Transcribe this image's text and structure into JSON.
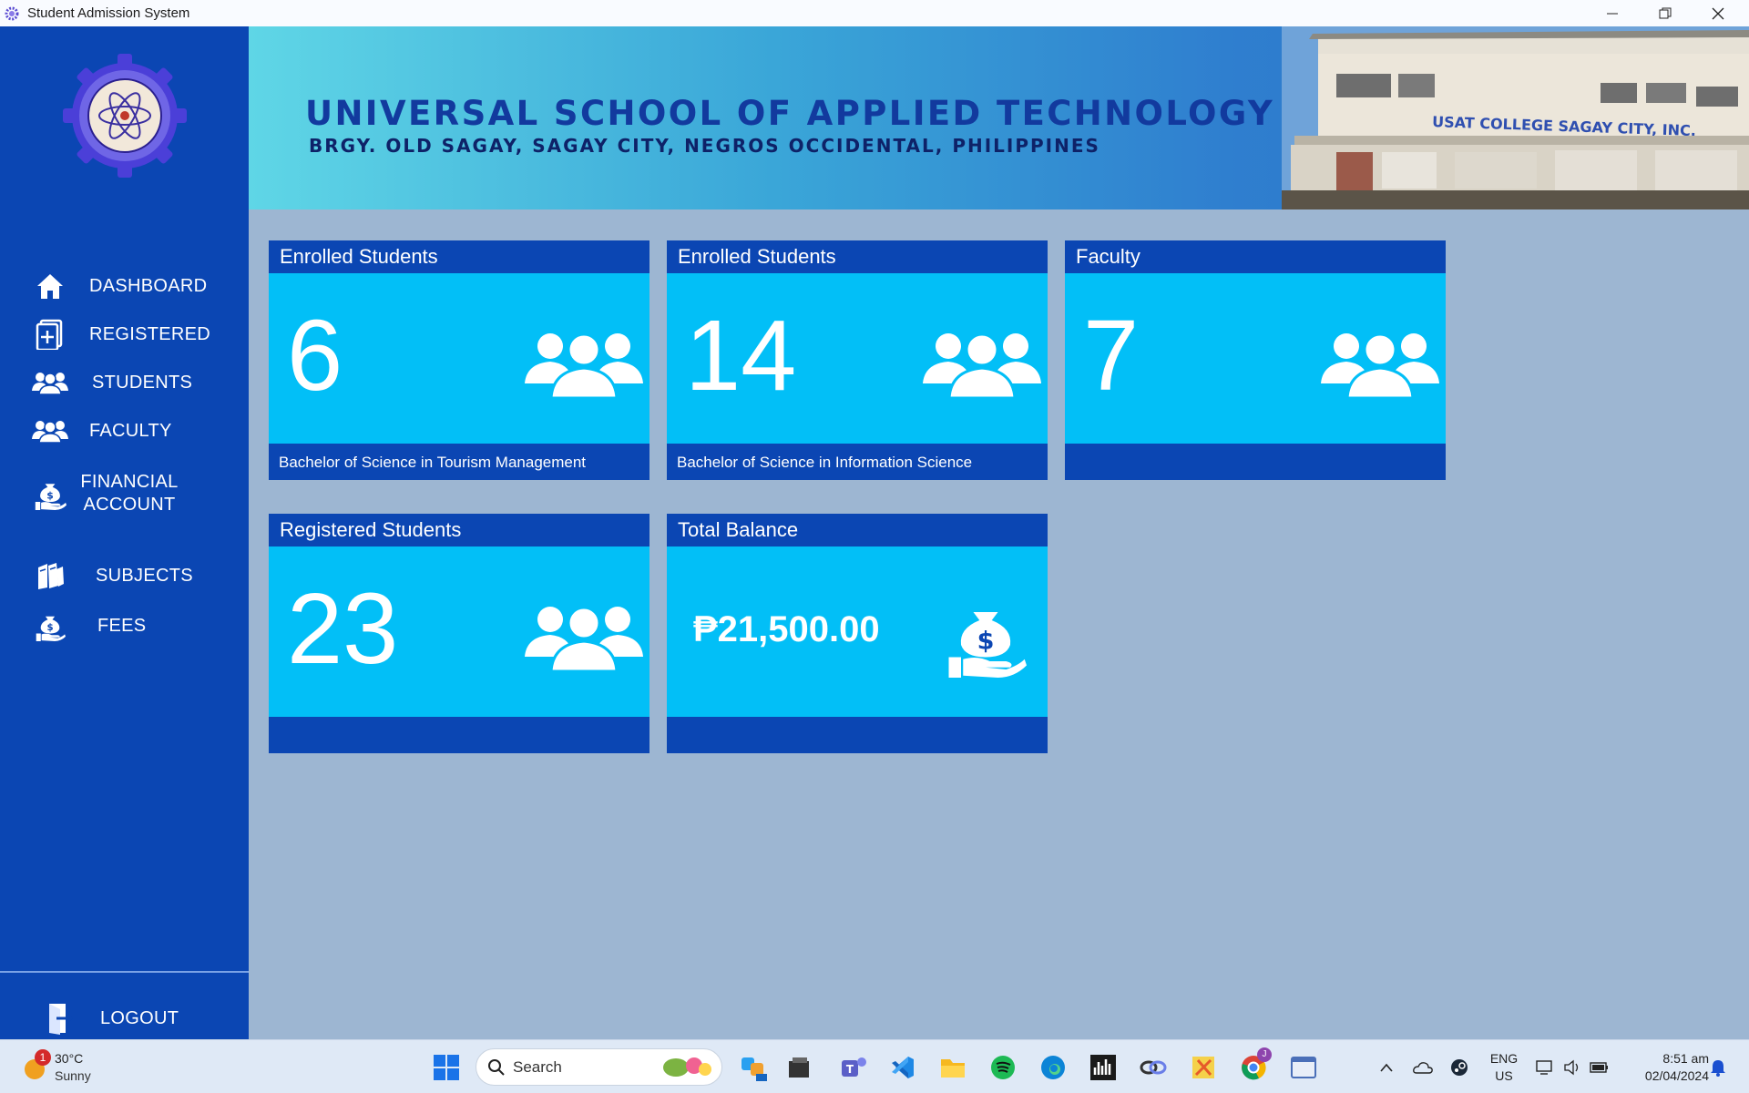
{
  "window": {
    "title": "Student Admission System"
  },
  "sidebar": {
    "items": [
      {
        "label": "DASHBOARD",
        "icon": "home-icon"
      },
      {
        "label": "REGISTERED",
        "icon": "add-document-icon"
      },
      {
        "label": "STUDENTS",
        "icon": "users-icon"
      },
      {
        "label": "FACULTY",
        "icon": "users-icon"
      },
      {
        "label_line1": "FINANCIAL",
        "label_line2": "ACCOUNT",
        "icon": "money-hand-icon"
      },
      {
        "label": "SUBJECTS",
        "icon": "books-icon"
      },
      {
        "label": "FEES",
        "icon": "money-hand-icon"
      }
    ],
    "logout": "LOGOUT"
  },
  "banner": {
    "school_name": "UNIVERSAL SCHOOL OF APPLIED TECHNOLOGY",
    "address": "BRGY. OLD SAGAY, SAGAY CITY, NEGROS OCCIDENTAL, PHILIPPINES",
    "building_sign": "USAT COLLEGE SAGAY CITY, INC."
  },
  "cards": [
    {
      "title": "Enrolled Students",
      "value": "6",
      "footer": "Bachelor of Science in Tourism Management",
      "icon": "users-icon"
    },
    {
      "title": "Enrolled Students",
      "value": "14",
      "footer": "Bachelor of Science in Information Science",
      "icon": "users-icon"
    },
    {
      "title": "Faculty",
      "value": "7",
      "footer": "",
      "icon": "users-icon"
    },
    {
      "title": "Registered Students",
      "value": "23",
      "footer": "",
      "icon": "users-icon"
    },
    {
      "title": "Total Balance",
      "value": "₱21,500.00",
      "footer": "",
      "icon": "money-hand-icon"
    }
  ],
  "taskbar": {
    "weather": {
      "badge": "1",
      "temp": "30°C",
      "condition": "Sunny"
    },
    "search_placeholder": "Search",
    "language": {
      "line1": "ENG",
      "line2": "US"
    },
    "clock": {
      "time": "8:51 am",
      "date": "02/04/2024"
    },
    "chrome_badge": "J"
  },
  "colors": {
    "sidebar": "#0b46b3",
    "card": "#02bff7",
    "background": "#9db6d2"
  }
}
